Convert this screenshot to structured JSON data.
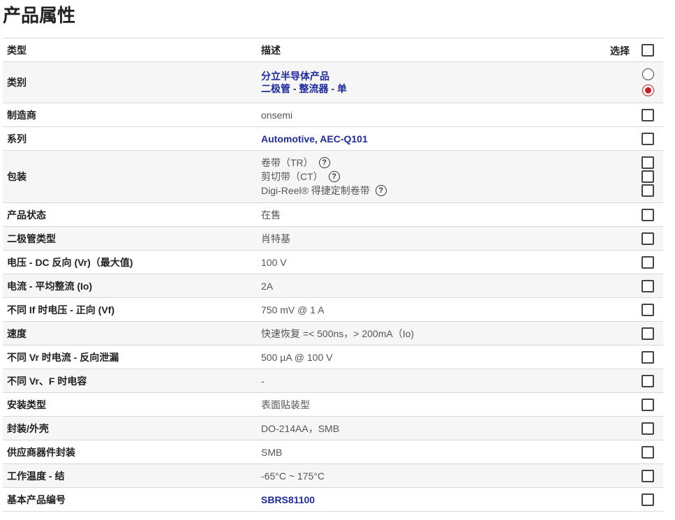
{
  "page": {
    "title": "产品属性"
  },
  "header": {
    "type": "类型",
    "desc": "描述",
    "select": "选择"
  },
  "rows": [
    {
      "label": "类别",
      "lines": [
        "分立半导体产品",
        "二极管 - 整流器 - 单"
      ]
    },
    {
      "label": "制造商",
      "value": "onsemi"
    },
    {
      "label": "系列",
      "value": "Automotive, AEC-Q101"
    },
    {
      "label": "包装",
      "packages": [
        "卷带（TR）",
        "剪切带（CT）",
        "Digi-Reel® 得捷定制卷带"
      ]
    },
    {
      "label": "产品状态",
      "value": "在售"
    },
    {
      "label": "二极管类型",
      "value": "肖特基"
    },
    {
      "label": "电压 - DC 反向 (Vr)（最大值)",
      "value": "100 V"
    },
    {
      "label": "电流 - 平均整流 (Io)",
      "value": "2A"
    },
    {
      "label": "不同 If 时电压 - 正向 (Vf)",
      "value": "750 mV @ 1 A"
    },
    {
      "label": "速度",
      "value": "快速恢复 =< 500ns，> 200mA（Io)"
    },
    {
      "label": "不同 Vr 时电流 - 反向泄漏",
      "value": "500 µA @ 100 V"
    },
    {
      "label": "不同 Vr、F 时电容",
      "value": "-"
    },
    {
      "label": "安装类型",
      "value": "表面贴装型"
    },
    {
      "label": "封装/外壳",
      "value": "DO-214AA，SMB"
    },
    {
      "label": "供应商器件封装",
      "value": "SMB"
    },
    {
      "label": "工作温度 - 结",
      "value": "-65°C ~ 175°C"
    },
    {
      "label": "基本产品编号",
      "value": "SBRS81100"
    }
  ],
  "icons": {
    "help": "?"
  },
  "colors": {
    "link": "#1f2a9e",
    "radio_selected": "#cc1d24"
  }
}
